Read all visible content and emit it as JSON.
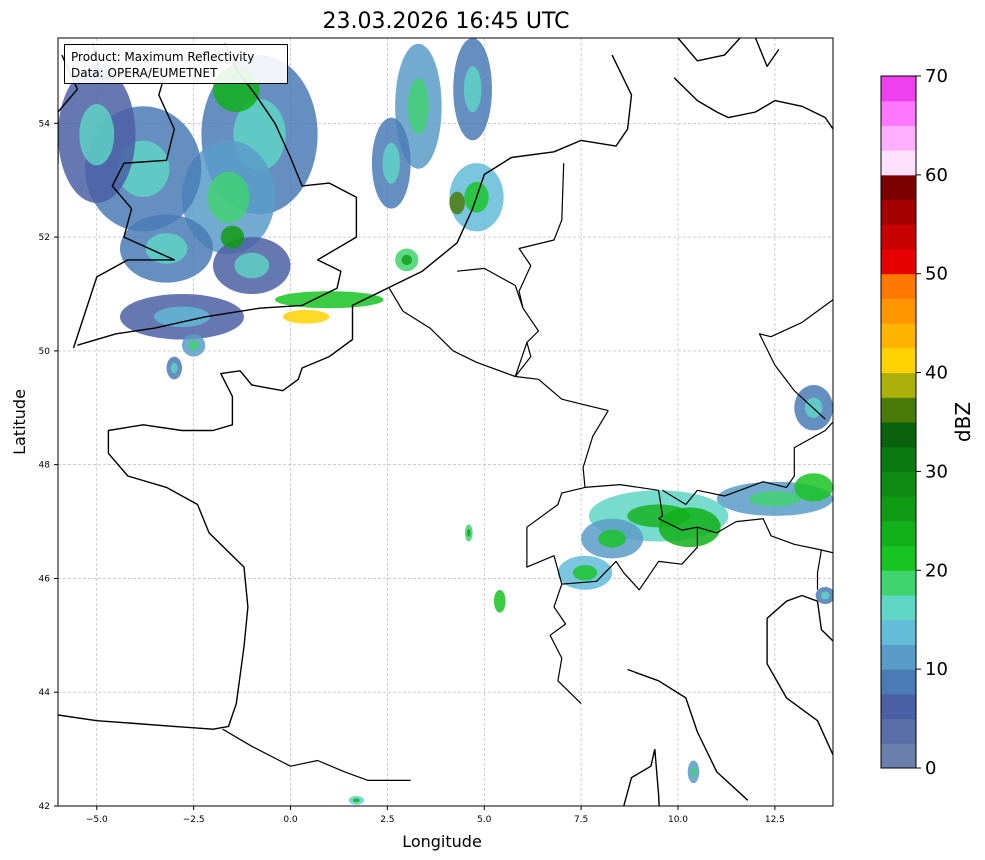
{
  "title": "23.03.2026 16:45 UTC",
  "info": {
    "product": "Product: Maximum Reflectivity",
    "data": "Data: OPERA/EUMETNET"
  },
  "axes": {
    "xlabel": "Longitude",
    "ylabel": "Latitude",
    "xlim": [
      -6,
      14
    ],
    "ylim": [
      42,
      55.5
    ],
    "xticks": [
      "−5.0",
      "−2.5",
      "0.0",
      "2.5",
      "5.0",
      "7.5",
      "10.0",
      "12.5"
    ],
    "yticks": [
      "42",
      "44",
      "46",
      "48",
      "50",
      "52",
      "54"
    ],
    "grid": true
  },
  "colorbar": {
    "label": "dBZ",
    "ticks": [
      "0",
      "10",
      "20",
      "30",
      "40",
      "50",
      "60",
      "70"
    ],
    "range": [
      0,
      70
    ],
    "colors": [
      "#6b7fad",
      "#5a6ea8",
      "#4b60a3",
      "#4a7bb5",
      "#5a9cc8",
      "#63bcd8",
      "#5fd6c6",
      "#3fd46e",
      "#17c422",
      "#12b01a",
      "#0f9c14",
      "#0c8a12",
      "#09780f",
      "#0a610c",
      "#4a7a0a",
      "#acb00a",
      "#ffd200",
      "#ffb400",
      "#ff9600",
      "#ff7800",
      "#e60000",
      "#c80000",
      "#a50000",
      "#7d0000",
      "#ffe0ff",
      "#ffb0ff",
      "#ff78ff",
      "#ee40ee"
    ]
  },
  "chart_data": {
    "type": "heatmap",
    "title": "23.03.2026 16:45 UTC",
    "xlabel": "Longitude",
    "ylabel": "Latitude",
    "xlim": [
      -6,
      14
    ],
    "ylim": [
      42,
      55.5
    ],
    "colorbar_label": "dBZ",
    "colorbar_range": [
      0,
      70
    ]
  },
  "map": {
    "coastlines": [
      [
        [
          -6,
          43.6
        ],
        [
          -5,
          43.5
        ],
        [
          -4,
          43.45
        ],
        [
          -3,
          43.4
        ],
        [
          -2,
          43.35
        ],
        [
          -1.6,
          43.4
        ],
        [
          -1.4,
          43.8
        ],
        [
          -1.2,
          44.8
        ],
        [
          -1.1,
          45.5
        ],
        [
          -1.2,
          46.2
        ],
        [
          -2.1,
          46.8
        ],
        [
          -2.4,
          47.3
        ],
        [
          -3.2,
          47.6
        ],
        [
          -4.2,
          47.8
        ],
        [
          -4.7,
          48.2
        ],
        [
          -4.7,
          48.6
        ],
        [
          -3.8,
          48.7
        ],
        [
          -2.8,
          48.6
        ],
        [
          -2,
          48.6
        ],
        [
          -1.5,
          48.7
        ],
        [
          -1.5,
          49.2
        ],
        [
          -1.8,
          49.6
        ],
        [
          -1.3,
          49.65
        ],
        [
          -1,
          49.4
        ],
        [
          -0.2,
          49.3
        ],
        [
          0.2,
          49.5
        ],
        [
          0.3,
          49.7
        ],
        [
          1,
          49.9
        ],
        [
          1.6,
          50.2
        ],
        [
          1.6,
          50.8
        ],
        [
          2.5,
          51.1
        ],
        [
          3.4,
          51.4
        ],
        [
          4.3,
          51.9
        ],
        [
          4.7,
          52.5
        ],
        [
          5,
          53.1
        ],
        [
          5.7,
          53.4
        ],
        [
          6.8,
          53.5
        ],
        [
          7.5,
          53.7
        ],
        [
          8.4,
          53.6
        ],
        [
          8.7,
          53.9
        ],
        [
          8.8,
          54.5
        ],
        [
          8.3,
          55.2
        ]
      ],
      [
        [
          -5.5,
          50.1
        ],
        [
          -4.5,
          50.3
        ],
        [
          -3.5,
          50.4
        ],
        [
          -2.2,
          50.6
        ],
        [
          -0.8,
          50.75
        ],
        [
          0.3,
          50.8
        ],
        [
          1.2,
          51.1
        ],
        [
          1.3,
          51.4
        ],
        [
          0.7,
          51.6
        ],
        [
          1.7,
          52.0
        ],
        [
          1.7,
          52.7
        ],
        [
          1.0,
          52.95
        ],
        [
          0.3,
          52.9
        ],
        [
          0.0,
          53.4
        ],
        [
          -0.4,
          54.0
        ],
        [
          -0.9,
          54.5
        ],
        [
          -1.4,
          54.95
        ],
        [
          -1.7,
          55.4
        ]
      ],
      [
        [
          -5.6,
          50.05
        ],
        [
          -5.0,
          51.3
        ],
        [
          -4.2,
          51.6
        ],
        [
          -3.0,
          51.6
        ],
        [
          -4.3,
          52.0
        ],
        [
          -4.1,
          52.5
        ],
        [
          -4.6,
          52.9
        ],
        [
          -4.3,
          53.3
        ],
        [
          -3.2,
          53.35
        ],
        [
          -3.0,
          53.9
        ],
        [
          -3.4,
          54.5
        ],
        [
          -3.2,
          54.95
        ],
        [
          -4.9,
          54.8
        ],
        [
          -5.1,
          55.4
        ]
      ],
      [
        [
          -6,
          53.3
        ],
        [
          -6,
          54.2
        ],
        [
          -5.5,
          54.6
        ],
        [
          -5.9,
          55.2
        ]
      ],
      [
        [
          8.7,
          44.4
        ],
        [
          9.5,
          44.2
        ],
        [
          10.2,
          43.9
        ],
        [
          10.5,
          43.3
        ],
        [
          11.0,
          42.6
        ],
        [
          11.8,
          42.1
        ]
      ],
      [
        [
          9.4,
          43.0
        ],
        [
          9.5,
          42.2
        ],
        [
          9.55,
          41.5
        ]
      ],
      [
        [
          8.6,
          42.0
        ],
        [
          8.8,
          42.5
        ],
        [
          9.3,
          42.7
        ],
        [
          9.4,
          43.0
        ]
      ],
      [
        [
          12.3,
          45.3
        ],
        [
          12.8,
          45.6
        ],
        [
          13.2,
          45.7
        ],
        [
          13.6,
          45.6
        ],
        [
          13.7,
          45.1
        ],
        [
          14,
          44.9
        ]
      ],
      [
        [
          12.3,
          45.3
        ],
        [
          12.3,
          44.5
        ],
        [
          12.8,
          43.9
        ],
        [
          13.6,
          43.5
        ],
        [
          14,
          42.9
        ]
      ],
      [
        [
          9.9,
          54.8
        ],
        [
          10.5,
          54.4
        ],
        [
          11.0,
          54.2
        ],
        [
          11.3,
          54.1
        ],
        [
          12.0,
          54.2
        ],
        [
          12.5,
          54.4
        ],
        [
          13.2,
          54.3
        ],
        [
          13.8,
          54.1
        ],
        [
          14,
          53.9
        ]
      ],
      [
        [
          10.0,
          55.5
        ],
        [
          10.5,
          55.1
        ],
        [
          11.2,
          55.2
        ],
        [
          11.6,
          55.5
        ]
      ],
      [
        [
          12.0,
          55.5
        ],
        [
          12.3,
          55.0
        ],
        [
          12.6,
          55.3
        ]
      ]
    ],
    "borders": [
      [
        [
          -1.75,
          43.35
        ],
        [
          -1.0,
          43.05
        ],
        [
          0.0,
          42.7
        ],
        [
          0.7,
          42.8
        ],
        [
          1.4,
          42.6
        ],
        [
          2.0,
          42.45
        ],
        [
          3.1,
          42.45
        ]
      ],
      [
        [
          2.55,
          51.1
        ],
        [
          2.9,
          50.7
        ],
        [
          3.6,
          50.4
        ],
        [
          4.2,
          50.0
        ],
        [
          4.8,
          49.8
        ],
        [
          5.8,
          49.55
        ]
      ],
      [
        [
          5.8,
          49.55
        ],
        [
          6.4,
          49.5
        ],
        [
          7.0,
          49.15
        ],
        [
          7.6,
          49.05
        ],
        [
          8.2,
          48.95
        ]
      ],
      [
        [
          8.2,
          48.95
        ],
        [
          7.8,
          48.5
        ],
        [
          7.55,
          47.95
        ],
        [
          7.6,
          47.6
        ]
      ],
      [
        [
          7.6,
          47.6
        ],
        [
          7.0,
          47.5
        ],
        [
          6.9,
          47.3
        ],
        [
          6.1,
          46.9
        ],
        [
          6.1,
          46.2
        ],
        [
          6.8,
          46.4
        ],
        [
          7.0,
          45.9
        ]
      ],
      [
        [
          7.0,
          45.9
        ],
        [
          6.8,
          45.5
        ],
        [
          7.1,
          45.2
        ],
        [
          6.7,
          45.0
        ],
        [
          7.0,
          44.6
        ],
        [
          6.9,
          44.2
        ],
        [
          7.5,
          43.8
        ]
      ],
      [
        [
          7.6,
          47.6
        ],
        [
          8.5,
          47.65
        ],
        [
          9.5,
          47.55
        ],
        [
          9.6,
          47.1
        ],
        [
          9.5,
          47.05
        ]
      ],
      [
        [
          9.5,
          47.05
        ],
        [
          10.1,
          46.85
        ],
        [
          10.5,
          46.9
        ],
        [
          10.5,
          46.55
        ],
        [
          10.1,
          46.25
        ],
        [
          9.5,
          46.3
        ],
        [
          9.0,
          45.8
        ],
        [
          8.6,
          46.1
        ],
        [
          8.4,
          46.3
        ],
        [
          7.9,
          45.95
        ],
        [
          7.0,
          45.9
        ]
      ],
      [
        [
          9.6,
          47.55
        ],
        [
          10.2,
          47.3
        ],
        [
          10.5,
          47.55
        ],
        [
          11.2,
          47.45
        ],
        [
          12.2,
          47.7
        ],
        [
          12.8,
          47.6
        ],
        [
          13.0,
          47.8
        ],
        [
          13.0,
          48.3
        ],
        [
          13.8,
          48.6
        ],
        [
          14,
          48.75
        ]
      ],
      [
        [
          10.5,
          46.9
        ],
        [
          11.0,
          46.8
        ],
        [
          11.5,
          47.0
        ],
        [
          12.2,
          47.05
        ],
        [
          12.4,
          46.75
        ],
        [
          13.0,
          46.6
        ],
        [
          13.7,
          46.5
        ],
        [
          14,
          46.45
        ]
      ],
      [
        [
          13.7,
          46.5
        ],
        [
          13.6,
          46.1
        ],
        [
          13.6,
          45.8
        ]
      ],
      [
        [
          5.8,
          49.55
        ],
        [
          6.1,
          50.15
        ],
        [
          6.4,
          50.35
        ],
        [
          6.0,
          50.75
        ],
        [
          5.9,
          51.05
        ],
        [
          6.2,
          51.5
        ],
        [
          5.9,
          51.8
        ],
        [
          6.8,
          51.95
        ],
        [
          7.0,
          52.3
        ],
        [
          7.05,
          53.3
        ]
      ],
      [
        [
          5.8,
          49.55
        ],
        [
          6.2,
          49.9
        ],
        [
          6.1,
          50.15
        ]
      ],
      [
        [
          4.3,
          51.4
        ],
        [
          5.0,
          51.45
        ],
        [
          5.8,
          51.15
        ],
        [
          6.0,
          50.75
        ]
      ],
      [
        [
          14,
          50.9
        ],
        [
          13.2,
          50.5
        ],
        [
          12.4,
          50.25
        ],
        [
          12.1,
          50.3
        ],
        [
          12.5,
          49.75
        ],
        [
          13.0,
          49.3
        ],
        [
          13.8,
          48.8
        ]
      ]
    ],
    "echoes": [
      {
        "lon": -0.8,
        "lat": 53.8,
        "rx": 1.5,
        "ry": 1.4,
        "dbz": 8
      },
      {
        "lon": -1.6,
        "lat": 52.7,
        "rx": 1.2,
        "ry": 1.0,
        "dbz": 10
      },
      {
        "lon": -3.8,
        "lat": 53.2,
        "rx": 1.5,
        "ry": 1.1,
        "dbz": 9
      },
      {
        "lon": -5.0,
        "lat": 53.8,
        "rx": 1.0,
        "ry": 1.2,
        "dbz": 7
      },
      {
        "lon": -3.2,
        "lat": 51.8,
        "rx": 1.2,
        "ry": 0.6,
        "dbz": 8
      },
      {
        "lon": -1.0,
        "lat": 51.5,
        "rx": 1.0,
        "ry": 0.5,
        "dbz": 7
      },
      {
        "lon": -2.8,
        "lat": 50.6,
        "rx": 1.6,
        "ry": 0.4,
        "dbz": 6
      },
      {
        "lon": -1.4,
        "lat": 54.6,
        "rx": 0.6,
        "ry": 0.4,
        "dbz": 24
      },
      {
        "lon": -1.5,
        "lat": 52.0,
        "rx": 0.3,
        "ry": 0.2,
        "dbz": 25
      },
      {
        "lon": 3.3,
        "lat": 54.3,
        "rx": 0.6,
        "ry": 1.1,
        "dbz": 10
      },
      {
        "lon": 4.7,
        "lat": 54.6,
        "rx": 0.5,
        "ry": 0.9,
        "dbz": 9
      },
      {
        "lon": 2.6,
        "lat": 53.3,
        "rx": 0.5,
        "ry": 0.8,
        "dbz": 8
      },
      {
        "lon": 4.8,
        "lat": 52.7,
        "rx": 0.7,
        "ry": 0.6,
        "dbz": 14
      },
      {
        "lon": 4.3,
        "lat": 52.6,
        "rx": 0.2,
        "ry": 0.2,
        "dbz": 36
      },
      {
        "lon": 1.0,
        "lat": 50.9,
        "rx": 1.4,
        "ry": 0.15,
        "dbz": 22
      },
      {
        "lon": 0.4,
        "lat": 50.6,
        "rx": 0.6,
        "ry": 0.12,
        "dbz": 40
      },
      {
        "lon": 3.0,
        "lat": 51.6,
        "rx": 0.3,
        "ry": 0.2,
        "dbz": 18
      },
      {
        "lon": 9.5,
        "lat": 47.1,
        "rx": 1.8,
        "ry": 0.45,
        "dbz": 16
      },
      {
        "lon": 10.3,
        "lat": 46.9,
        "rx": 0.8,
        "ry": 0.35,
        "dbz": 24
      },
      {
        "lon": 8.3,
        "lat": 46.7,
        "rx": 0.8,
        "ry": 0.35,
        "dbz": 12
      },
      {
        "lon": 12.5,
        "lat": 47.4,
        "rx": 1.5,
        "ry": 0.3,
        "dbz": 10
      },
      {
        "lon": 13.5,
        "lat": 47.6,
        "rx": 0.5,
        "ry": 0.25,
        "dbz": 20
      },
      {
        "lon": 7.6,
        "lat": 46.1,
        "rx": 0.7,
        "ry": 0.3,
        "dbz": 14
      },
      {
        "lon": 5.4,
        "lat": 45.6,
        "rx": 0.15,
        "ry": 0.2,
        "dbz": 20
      },
      {
        "lon": 13.5,
        "lat": 49.0,
        "rx": 0.5,
        "ry": 0.4,
        "dbz": 8
      },
      {
        "lon": 13.8,
        "lat": 45.7,
        "rx": 0.25,
        "ry": 0.15,
        "dbz": 8
      },
      {
        "lon": 10.4,
        "lat": 42.6,
        "rx": 0.15,
        "ry": 0.2,
        "dbz": 10
      },
      {
        "lon": 4.6,
        "lat": 46.8,
        "rx": 0.1,
        "ry": 0.15,
        "dbz": 18
      },
      {
        "lon": -2.5,
        "lat": 50.1,
        "rx": 0.3,
        "ry": 0.2,
        "dbz": 10
      },
      {
        "lon": -3.0,
        "lat": 49.7,
        "rx": 0.2,
        "ry": 0.2,
        "dbz": 8
      },
      {
        "lon": 1.7,
        "lat": 42.1,
        "rx": 0.2,
        "ry": 0.08,
        "dbz": 15
      }
    ]
  }
}
